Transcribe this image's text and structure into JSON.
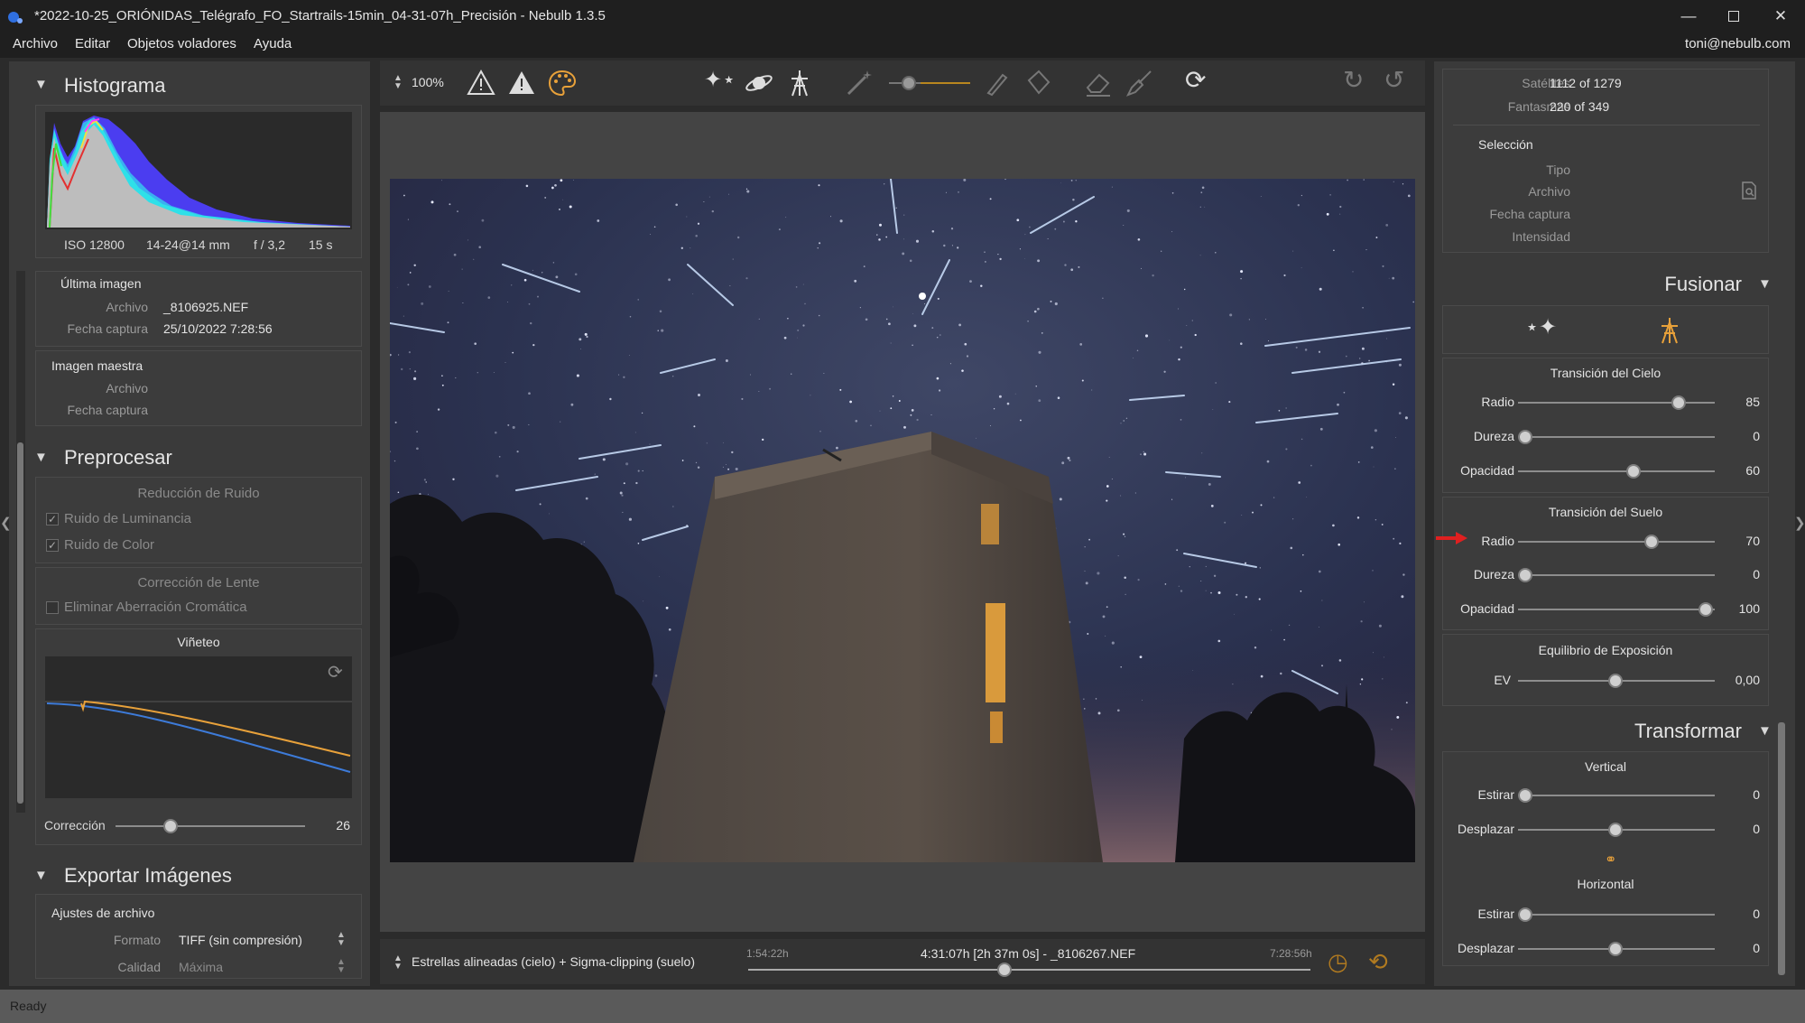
{
  "window": {
    "title": "*2022-10-25_ORIÓNIDAS_Telégrafo_FO_Startrails-15min_04-31-07h_Precisión - Nebulb 1.3.5",
    "minimize_icon": "minimize-icon",
    "maximize_icon": "maximize-icon",
    "close_icon": "close-icon"
  },
  "menu": {
    "items": [
      "Archivo",
      "Editar",
      "Objetos voladores",
      "Ayuda"
    ],
    "user": "toni@nebulb.com"
  },
  "histogram": {
    "title": "Histograma",
    "iso": "ISO 12800",
    "lens": "14-24@14 mm",
    "aperture": "f / 3,2",
    "shutter": "15 s"
  },
  "last_image": {
    "title": "Última imagen",
    "file_label": "Archivo",
    "file_value": "_8106925.NEF",
    "date_label": "Fecha captura",
    "date_value": "25/10/2022 7:28:56"
  },
  "master_image": {
    "title": "Imagen maestra",
    "file_label": "Archivo",
    "date_label": "Fecha captura"
  },
  "preprocess": {
    "title": "Preprocesar",
    "noise_title": "Reducción de Ruido",
    "luminance": "Ruido de Luminancia",
    "color": "Ruido de Color",
    "lens_title": "Corrección de Lente",
    "chromatic": "Eliminar Aberración Cromática",
    "vignette_title": "Viñeteo",
    "correction_label": "Corrección",
    "correction_value": "26",
    "correction_level": 0.28
  },
  "export": {
    "title": "Exportar Imágenes",
    "file_settings": "Ajustes de archivo",
    "format_label": "Formato",
    "format_value": "TIFF (sin compresión)",
    "quality_label": "Calidad",
    "quality_value": "Máxima"
  },
  "toolbar": {
    "zoom": "100%"
  },
  "timeline": {
    "mode": "Estrellas alineadas (cielo) + Sigma-clipping (suelo)",
    "start": "1:54:22h",
    "current": "4:31:07h [2h 37m 0s] - _8106267.NEF",
    "end": "7:28:56h",
    "position": 0.46
  },
  "info": {
    "satellites_label": "Satélites",
    "satellites_value": "1112 of 1279",
    "ghosts_label": "Fantasmas",
    "ghosts_value": "220 of 349",
    "selection_title": "Selección",
    "type_label": "Tipo",
    "file_label": "Archivo",
    "date_label": "Fecha captura",
    "intensity_label": "Intensidad"
  },
  "fusion": {
    "title": "Fusionar",
    "sky_title": "Transición del Cielo",
    "sky": [
      {
        "label": "Radio",
        "value": "85",
        "level": 0.85
      },
      {
        "label": "Dureza",
        "value": "0",
        "level": 0
      },
      {
        "label": "Opacidad",
        "value": "60",
        "level": 0.6
      }
    ],
    "ground_title": "Transición del Suelo",
    "ground": [
      {
        "label": "Radio",
        "value": "70",
        "level": 0.7
      },
      {
        "label": "Dureza",
        "value": "0",
        "level": 0
      },
      {
        "label": "Opacidad",
        "value": "100",
        "level": 1
      }
    ],
    "exposure_title": "Equilibrio de Exposición",
    "ev_label": "EV",
    "ev_value": "0,00",
    "ev_level": 0.5
  },
  "transform": {
    "title": "Transformar",
    "vertical_title": "Vertical",
    "vertical": [
      {
        "label": "Estirar",
        "value": "0",
        "level": 0
      },
      {
        "label": "Desplazar",
        "value": "0",
        "level": 0.5
      }
    ],
    "horizontal_title": "Horizontal",
    "horizontal": [
      {
        "label": "Estirar",
        "value": "0",
        "level": 0
      },
      {
        "label": "Desplazar",
        "value": "0",
        "level": 0.5
      }
    ]
  },
  "status": "Ready",
  "colors": {
    "accent": "#e8a13a",
    "arrow": "#e02020"
  }
}
